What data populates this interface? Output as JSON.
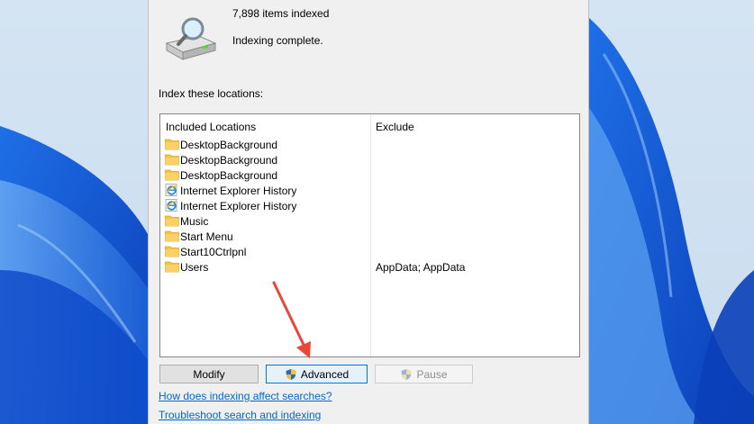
{
  "index_status": {
    "items_count": "7,898 items indexed",
    "status": "Indexing complete."
  },
  "locations": {
    "label": "Index these locations:",
    "columns": {
      "included": "Included Locations",
      "exclude": "Exclude"
    },
    "rows": [
      {
        "name": "DesktopBackground",
        "exclude": "",
        "icon": "folder-icon"
      },
      {
        "name": "DesktopBackground",
        "exclude": "",
        "icon": "folder-icon"
      },
      {
        "name": "DesktopBackground",
        "exclude": "",
        "icon": "folder-icon"
      },
      {
        "name": "Internet Explorer History",
        "exclude": "",
        "icon": "internet-explorer-icon"
      },
      {
        "name": "Internet Explorer History",
        "exclude": "",
        "icon": "internet-explorer-icon"
      },
      {
        "name": "Music",
        "exclude": "",
        "icon": "folder-icon"
      },
      {
        "name": "Start Menu",
        "exclude": "",
        "icon": "folder-icon"
      },
      {
        "name": "Start10Ctrlpnl",
        "exclude": "",
        "icon": "folder-icon"
      },
      {
        "name": "Users",
        "exclude": "AppData; AppData",
        "icon": "folder-icon"
      }
    ]
  },
  "buttons": {
    "modify": "Modify",
    "advanced": "Advanced",
    "pause": "Pause"
  },
  "links": {
    "how_indexing": "How does indexing affect searches?",
    "troubleshoot": "Troubleshoot search and indexing"
  },
  "colors": {
    "link": "#0066cc",
    "annotation_arrow": "#e8473a",
    "folder": "#f5c542"
  }
}
